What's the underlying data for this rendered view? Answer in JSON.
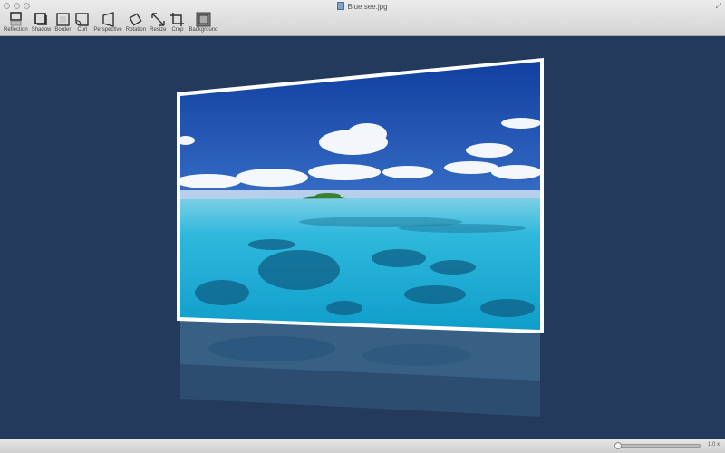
{
  "window": {
    "title": "Blue see.jpg",
    "file_icon": "image-file-icon"
  },
  "toolbar": {
    "tools": [
      {
        "label": "Reflection",
        "icon": "reflection-icon"
      },
      {
        "label": "Shadow",
        "icon": "shadow-icon"
      },
      {
        "label": "Border",
        "icon": "border-icon"
      },
      {
        "label": "Curl",
        "icon": "curl-icon"
      },
      {
        "label": "Perspective",
        "icon": "perspective-icon"
      },
      {
        "label": "Rotation",
        "icon": "rotation-icon"
      },
      {
        "label": "Resize",
        "icon": "resize-icon"
      },
      {
        "label": "Crop",
        "icon": "crop-icon"
      },
      {
        "label": "Background",
        "icon": "background-icon"
      }
    ]
  },
  "statusbar": {
    "zoom_label": "1.0 x",
    "zoom_slider_value": 0
  },
  "colors": {
    "canvas_background": "#243a5c",
    "frame_border": "#ffffff",
    "sky": "#2a5fb8",
    "sea": "#1ab1d4"
  }
}
